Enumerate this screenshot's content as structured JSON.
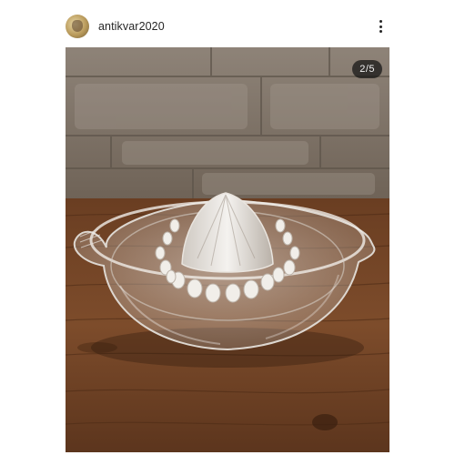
{
  "post": {
    "username": "antikvar2020",
    "media_counter": "2/5"
  },
  "icons": {
    "avatar": "profile-picture",
    "more": "more-options-icon"
  }
}
